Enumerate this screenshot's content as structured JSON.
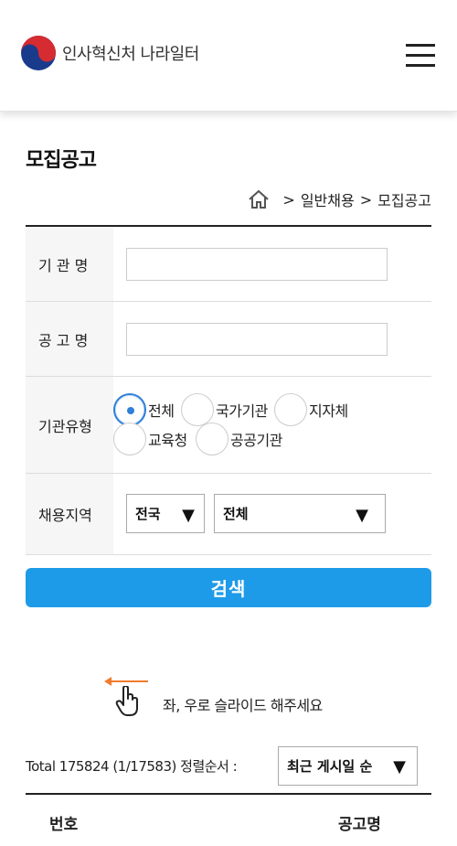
{
  "header": {
    "logo_text": "인사혁신처 나라일터",
    "menu_icon": "hamburger-menu-icon"
  },
  "page": {
    "title": "모집공고"
  },
  "breadcrumb": {
    "home_icon": "home-icon",
    "items": [
      "일반채용",
      "모집공고"
    ],
    "separator": ">"
  },
  "form": {
    "institution_label": "기 관 명",
    "institution_value": "",
    "notice_label": "공 고 명",
    "notice_value": "",
    "type_label": "기관유형",
    "type_options": [
      "전체",
      "국가기관",
      "지자체",
      "교육청",
      "공공기관"
    ],
    "type_selected": "전체",
    "region_label": "채용지역",
    "region_primary": "전국",
    "region_secondary": "전체"
  },
  "search_button": "검색",
  "slide_hint": {
    "text": "좌, 우로 슬라이드 해주세요",
    "icon": "hand-pointer-icon"
  },
  "results": {
    "total_text": "Total 175824 (1/17583)",
    "sort_label": "정렬순서 :",
    "sort_value": "최근 게시일 순"
  },
  "table": {
    "columns": [
      "번호",
      "공고명"
    ]
  },
  "colors": {
    "accent": "#1e9be8",
    "radio_checked": "#2f7fd8",
    "hint_arrow": "#f07c2c"
  }
}
